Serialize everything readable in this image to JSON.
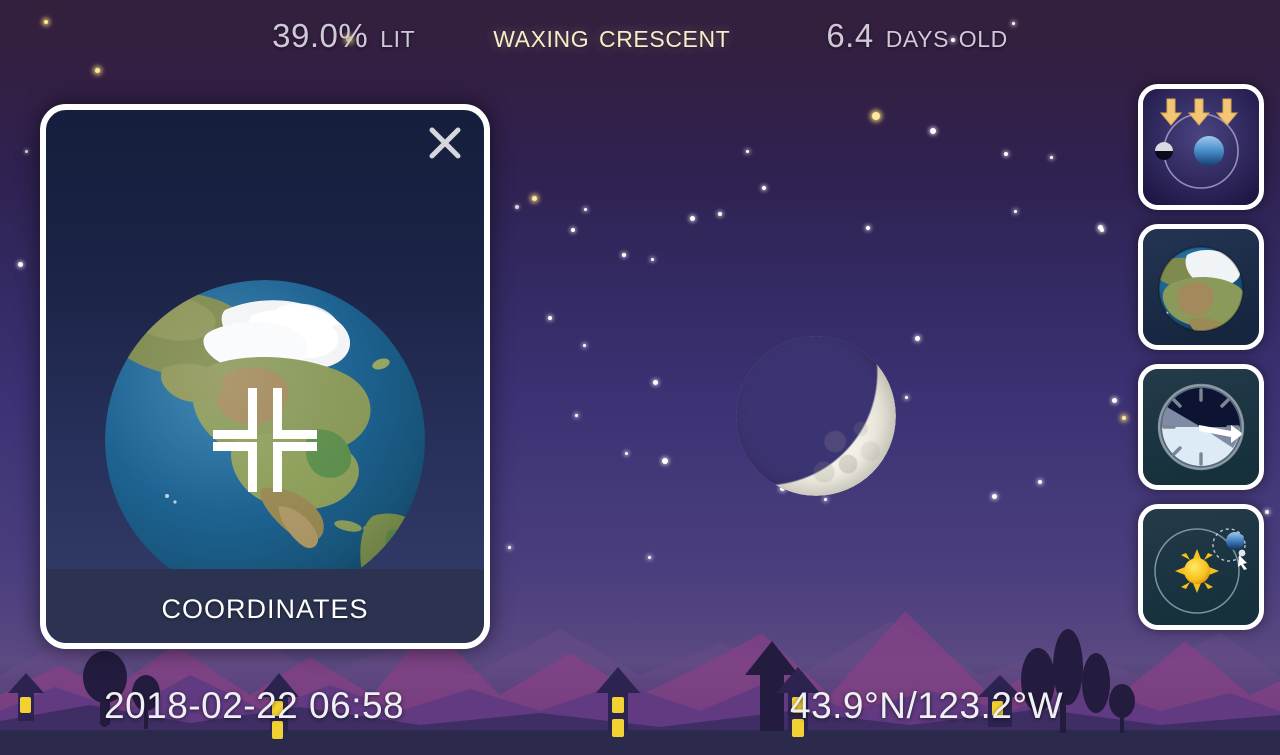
{
  "header": {
    "illumination_value": "39.0%",
    "illumination_label": "Lit",
    "phase_name": "Waxing crescent",
    "age_value": "6.4",
    "age_label": "Days old"
  },
  "footer": {
    "datetime": "2018-02-22  06:58",
    "coordinates": "43.9°N/123.2°W"
  },
  "card": {
    "title": "Coordinates",
    "close_icon": "close-icon",
    "globe_icon": "earth-globe",
    "marker_icon": "crosshair-marker"
  },
  "sidebar": {
    "buttons": [
      {
        "name": "moon-phase-diagram",
        "icon": "moon-earth-orbit-icon"
      },
      {
        "name": "coordinates-globe",
        "icon": "earth-globe-icon"
      },
      {
        "name": "time-clock",
        "icon": "clock-dial-icon"
      },
      {
        "name": "solar-system",
        "icon": "sun-orbit-icon"
      }
    ]
  },
  "scene": {
    "moon_icon": "waxing-crescent-moon",
    "sky_icon": "night-sky",
    "landscape_icon": "mountain-silhouette"
  },
  "colors": {
    "sky_top": "#33203d",
    "sky_bottom": "#5b4a82",
    "phase_accent": "#f6edca",
    "header_text": "#cfc8d8",
    "footer_text": "#eef0f5",
    "card_border": "#ffffff",
    "card_bg_top": "#161e3d",
    "card_bg_bottom": "#303a66",
    "card_label_bg": "#2b3350",
    "ocean": "#1d6291",
    "ground": "#2a2a4a",
    "window_light": "#f2d132"
  }
}
